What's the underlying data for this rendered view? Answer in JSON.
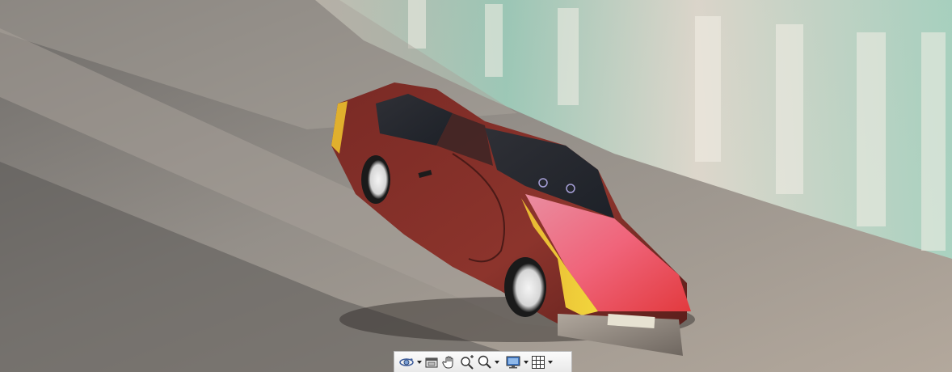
{
  "viewer": {
    "scene": "3d-car-model-viewport",
    "model_body_color": "#8a2e28",
    "hood_color": "#e8545a",
    "background_facade_color": "#8fd1b8"
  },
  "toolbar": {
    "buttons": [
      {
        "icon": "orbit-icon",
        "has_dropdown": true
      },
      {
        "icon": "camera-icon",
        "has_dropdown": false
      },
      {
        "icon": "pan-hand-icon",
        "has_dropdown": false
      },
      {
        "icon": "zoom-window-icon",
        "has_dropdown": false
      },
      {
        "icon": "zoom-icon",
        "has_dropdown": true
      },
      {
        "icon": "display-monitor-icon",
        "has_dropdown": true
      },
      {
        "icon": "grid-icon",
        "has_dropdown": true
      }
    ]
  }
}
